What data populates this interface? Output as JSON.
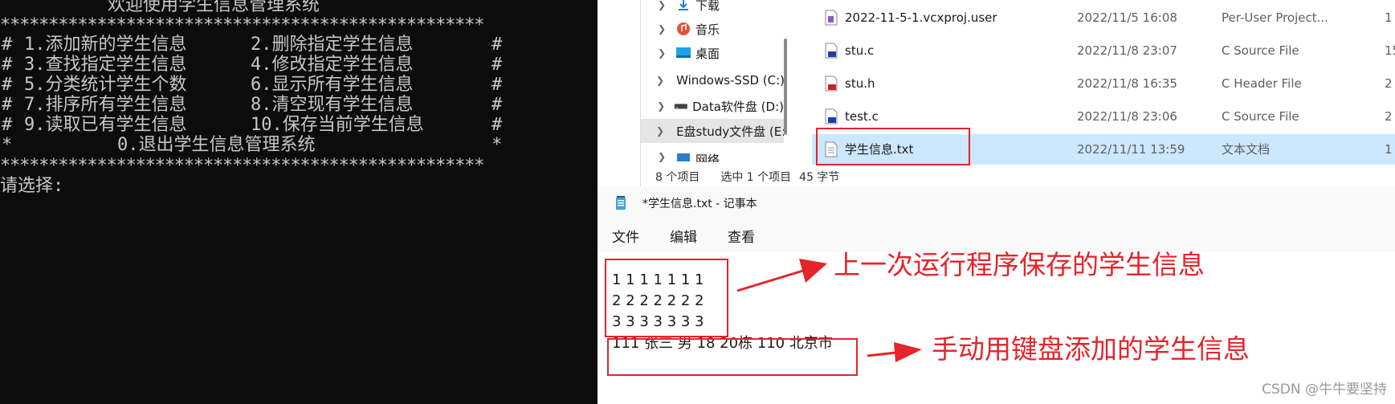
{
  "console": {
    "title": "欢迎使用学生信息管理系统",
    "border": "**************************************************",
    "menu_rows": [
      {
        "left_edge": "#",
        "item1": "1.添加新的学生信息",
        "item2": "2.删除指定学生信息",
        "right_edge": "#"
      },
      {
        "left_edge": "#",
        "item1": "3.查找指定学生信息",
        "item2": "4.修改指定学生信息",
        "right_edge": "#"
      },
      {
        "left_edge": "#",
        "item1": "5.分类统计学生个数",
        "item2": "6.显示所有学生信息",
        "right_edge": "#"
      },
      {
        "left_edge": "#",
        "item1": "7.排序所有学生信息",
        "item2": "8.清空现有学生信息",
        "right_edge": "#"
      },
      {
        "left_edge": "#",
        "item1": "9.读取已有学生信息",
        "item2": "10.保存当前学生信息",
        "right_edge": "#"
      }
    ],
    "exit_row": {
      "left_edge": "*",
      "item": "0.退出学生信息管理系统",
      "right_edge": "*"
    },
    "prompt": "请选择:"
  },
  "explorer": {
    "nav": [
      {
        "label": "下载",
        "icon": "download-icon",
        "color": "#2b7cd3"
      },
      {
        "label": "音乐",
        "icon": "music-icon",
        "color": "#e0533a"
      },
      {
        "label": "桌面",
        "icon": "desktop-icon",
        "color": "#1ea2e5"
      },
      {
        "label": "Windows-SSD (C:)",
        "icon": "drive-icon",
        "color": "#555555"
      },
      {
        "label": "Data软件盘 (D:)",
        "icon": "drive-icon",
        "color": "#555555"
      },
      {
        "label": "E盘study文件盘 (E:)",
        "icon": "drive-icon",
        "color": "#555555"
      },
      {
        "label": "网络",
        "icon": "network-icon",
        "color": "#2b7cd3"
      }
    ],
    "files": [
      {
        "name": "2022-11-5-1.vcxproj.user",
        "date": "2022/11/5 16:08",
        "type": "Per-User Project...",
        "size": "1",
        "icon": "user-file-icon"
      },
      {
        "name": "stu.c",
        "date": "2022/11/8 23:07",
        "type": "C Source File",
        "size": "15",
        "icon": "c-source-icon"
      },
      {
        "name": "stu.h",
        "date": "2022/11/8 16:35",
        "type": "C Header File",
        "size": "2",
        "icon": "c-header-icon"
      },
      {
        "name": "test.c",
        "date": "2022/11/8 23:06",
        "type": "C Source File",
        "size": "2",
        "icon": "c-source-icon"
      },
      {
        "name": "学生信息.txt",
        "date": "2022/11/11 13:59",
        "type": "文本文档",
        "size": "1",
        "icon": "text-file-icon"
      }
    ],
    "status": {
      "count": "8 个项目",
      "selection": "选中 1 个项目",
      "bytes": "45 字节"
    }
  },
  "notepad": {
    "title": "*学生信息.txt - 记事本",
    "menu": [
      "文件",
      "编辑",
      "查看"
    ],
    "lines": [
      "1 1 1 1 1 1 1",
      "2 2 2 2 2 2 2",
      "3 3 3 3 3 3 3",
      "111 张三 男 18 20栋 110 北京市"
    ]
  },
  "annotations": {
    "saved": "上一次运行程序保存的学生信息",
    "manual": "手动用键盘添加的学生信息",
    "color": "#e5242b"
  },
  "watermark": "CSDN @牛牛要坚持"
}
